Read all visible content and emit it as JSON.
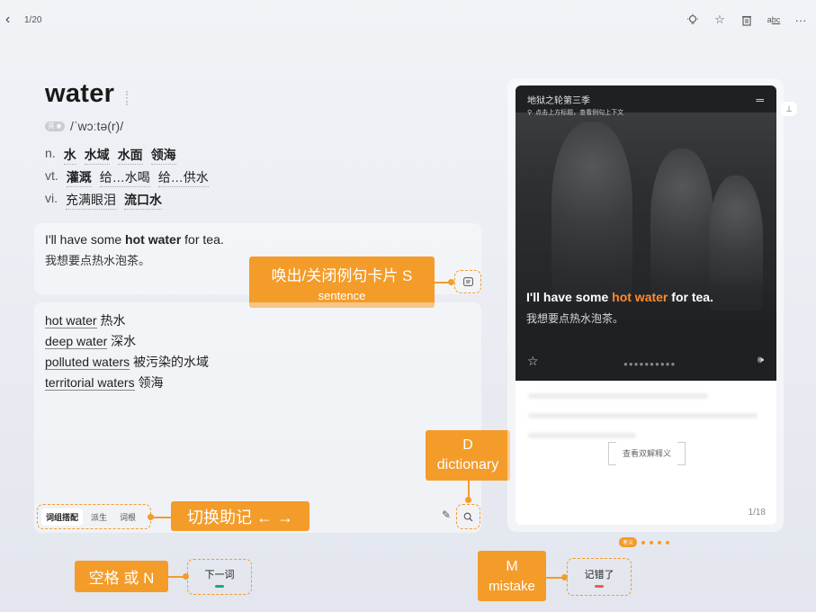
{
  "topbar": {
    "progress": "1/20",
    "icons": [
      "lightbulb-icon",
      "star-icon",
      "trash-icon",
      "spellcheck-icon",
      "more-icon"
    ]
  },
  "word": {
    "text": "water",
    "phonetic_badge": "英 ◉",
    "phonetic": "/ˈwɔːtə(r)/",
    "definitions": [
      {
        "pos": "n.",
        "meanings": [
          "水",
          "水域",
          "水面",
          "领海"
        ]
      },
      {
        "pos": "vt.",
        "meanings": [
          "灌溉",
          "给…水喝",
          "给…供水"
        ]
      },
      {
        "pos": "vi.",
        "meanings": [
          "充满眼泪",
          "流口水"
        ]
      }
    ]
  },
  "example": {
    "en_before": "I'll have some ",
    "en_highlight": "hot water",
    "en_after": " for tea.",
    "cn": "我想要点热水泡茶。"
  },
  "phrases": [
    {
      "en": "hot water",
      "cn": "热水"
    },
    {
      "en": "deep water",
      "cn": "深水"
    },
    {
      "en": "polluted waters",
      "cn": "被污染的水域"
    },
    {
      "en": "territorial waters",
      "cn": "领海"
    }
  ],
  "tabs": [
    "词组搭配",
    "派生",
    "词根"
  ],
  "hints": {
    "sentence_main": "唤出/关闭例句卡片 S",
    "sentence_sub": "sentence",
    "dict_main": "D",
    "dict_sub": "dictionary",
    "switch": "切换助记 ← →",
    "next_key": "空格 或 N",
    "mistake_main": "M",
    "mistake_sub": "mistake"
  },
  "video": {
    "title": "地狱之轮第三季",
    "subtitle": "点击上方标题，查看例句上下文",
    "en_before": "I'll have some ",
    "en_highlight": "hot water",
    "en_after": " for tea.",
    "cn": "我想要点热水泡茶。",
    "dots": "●●●●●●●●●●",
    "bilingual_link": "查看双解释义",
    "count": "1/18",
    "pin_icon": "pin-icon"
  },
  "pager": {
    "label": "考义"
  },
  "buttons": {
    "next": "下一词",
    "mistake": "记错了"
  },
  "colors": {
    "accent": "#f39c2a",
    "highlight": "#ff8a2a",
    "next_bar": "#1aa58d",
    "mistake_bar": "#f05a5a"
  }
}
